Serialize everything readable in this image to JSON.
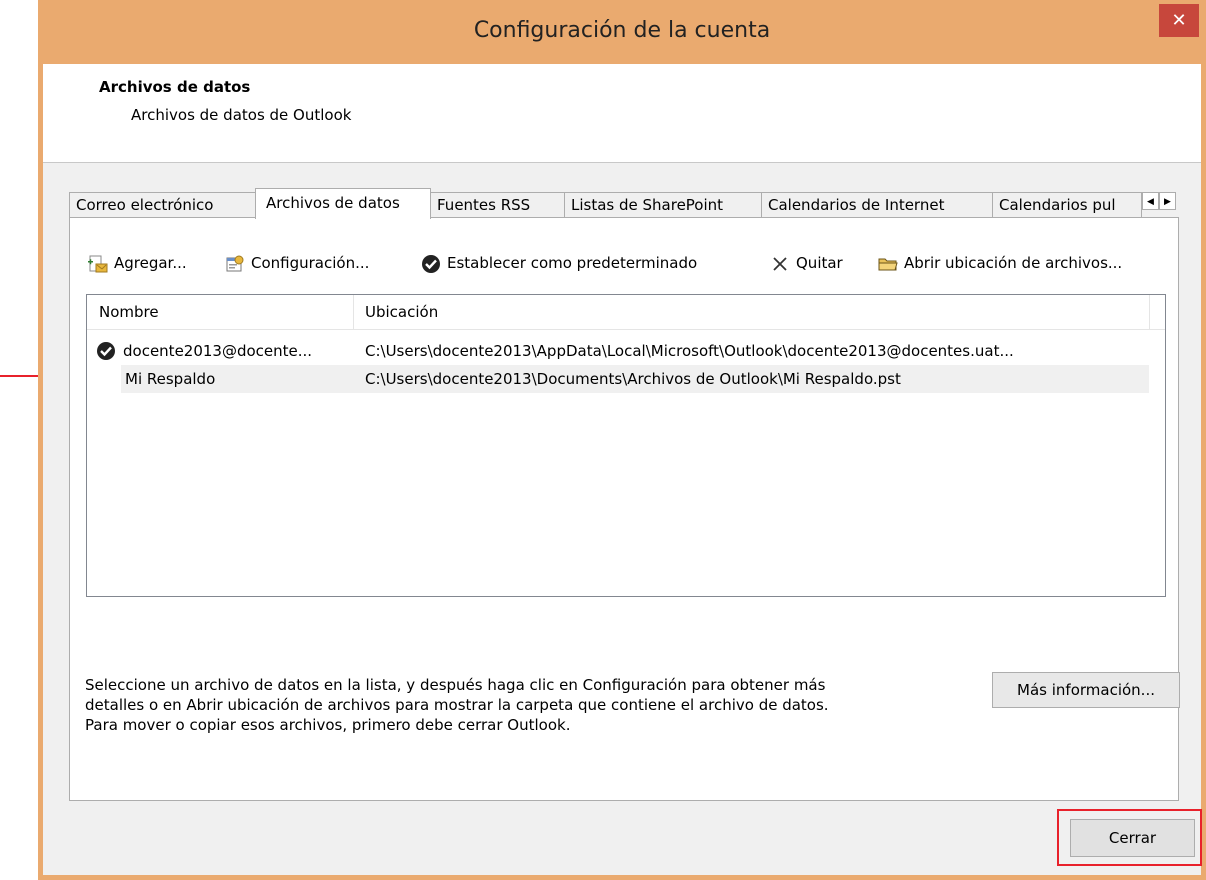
{
  "window": {
    "title": "Configuración de la cuenta",
    "close_label": "✕"
  },
  "header": {
    "title": "Archivos de datos",
    "subtitle": "Archivos de datos de Outlook"
  },
  "tabs": [
    {
      "label": "Correo electrónico"
    },
    {
      "label": "Archivos de datos"
    },
    {
      "label": "Fuentes RSS"
    },
    {
      "label": "Listas de SharePoint"
    },
    {
      "label": "Calendarios de Internet"
    },
    {
      "label": "Calendarios pul"
    }
  ],
  "tab_scroll": {
    "left": "◀",
    "right": "▶"
  },
  "toolbar": {
    "add": "Agregar...",
    "settings": "Configuración...",
    "set_default": "Establecer como predeterminado",
    "remove": "Quitar",
    "open_location": "Abrir ubicación de archivos..."
  },
  "list": {
    "columns": [
      "Nombre",
      "Ubicación"
    ],
    "rows": [
      {
        "name": "docente2013@docente...",
        "location": "C:\\Users\\docente2013\\AppData\\Local\\Microsoft\\Outlook\\docente2013@docentes.uat...",
        "is_default": true
      },
      {
        "name": "Mi Respaldo",
        "location": "C:\\Users\\docente2013\\Documents\\Archivos de Outlook\\Mi Respaldo.pst",
        "is_default": false
      }
    ]
  },
  "info": {
    "line1": "Seleccione un archivo de datos en la lista, y después haga clic en Configuración para obtener más",
    "line2": "detalles o en Abrir ubicación de archivos para mostrar la carpeta que contiene el archivo de datos.",
    "line3": "Para mover o copiar esos archivos, primero debe cerrar Outlook."
  },
  "buttons": {
    "more_info": "Más información...",
    "close": "Cerrar"
  },
  "colors": {
    "title_bar": "#eaaa6f",
    "close_button": "#c7473c",
    "annotation": "#e8212b"
  }
}
